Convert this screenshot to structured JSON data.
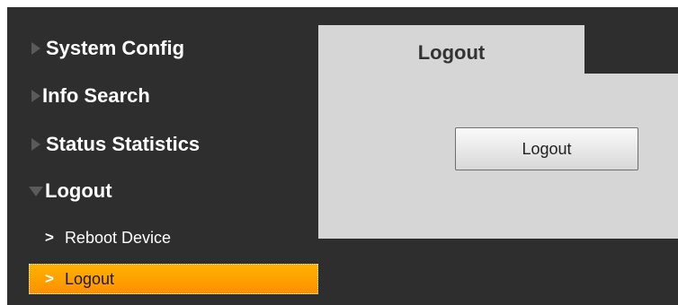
{
  "sidebar": {
    "menu": [
      {
        "label": "System Config",
        "expanded": false
      },
      {
        "label": "Info Search",
        "expanded": false
      },
      {
        "label": "Status Statistics",
        "expanded": false
      },
      {
        "label": "Logout",
        "expanded": true
      }
    ],
    "sub_items": [
      {
        "label": "Reboot Device",
        "active": false
      },
      {
        "label": "Logout",
        "active": true
      }
    ],
    "chevron": ">"
  },
  "panel": {
    "tab_label": "Logout",
    "button_label": "Logout"
  },
  "colors": {
    "background": "#2e2e2e",
    "panel": "#d6d6d6",
    "active_item": "#ffa000"
  }
}
